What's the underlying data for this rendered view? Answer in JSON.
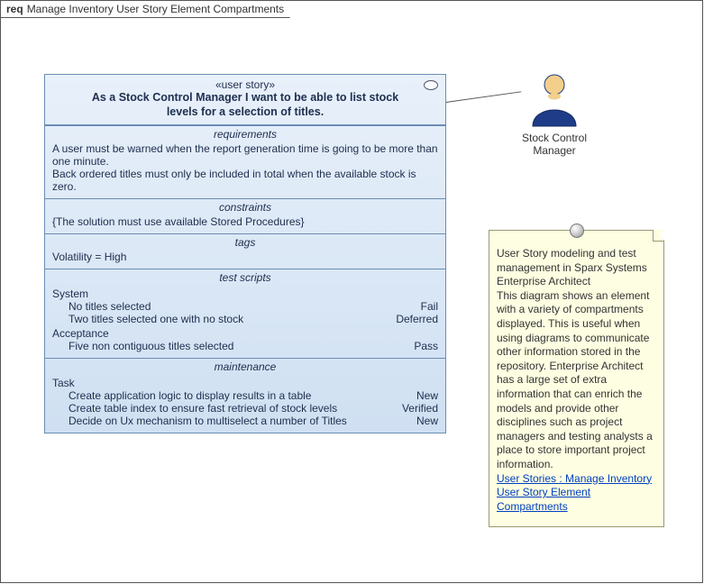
{
  "frame": {
    "prefix": "req",
    "title": "Manage Inventory User Story Element Compartments"
  },
  "story": {
    "stereotype": "«user story»",
    "title": "As a Stock Control Manager I want to be able to list stock levels for a selection of titles.",
    "requirements_label": "requirements",
    "requirements": {
      "r1": "A user must be warned when the report generation time is going to be more than one minute.",
      "r2": "Back ordered titles must only be included in total when the available stock is zero."
    },
    "constraints_label": "constraints",
    "constraints": {
      "c1": "{The solution must use available Stored Procedures}"
    },
    "tags_label": "tags",
    "tags": {
      "t1": "Volatility = High"
    },
    "test_scripts_label": "test scripts",
    "tests": {
      "system_label": "System",
      "system": {
        "s1_name": "No titles selected",
        "s1_status": "Fail",
        "s2_name": "Two titles selected one with no stock",
        "s2_status": "Deferred"
      },
      "acceptance_label": "Acceptance",
      "acceptance": {
        "a1_name": "Five non contiguous titles selected",
        "a1_status": "Pass"
      }
    },
    "maintenance_label": "maintenance",
    "maintenance": {
      "task_label": "Task",
      "m1_name": "Create application logic to display results in a table",
      "m1_status": "New",
      "m2_name": "Create table index to ensure fast retrieval of stock levels",
      "m2_status": "Verified",
      "m3_name": "Decide on Ux mechanism to multiselect a number of Titles",
      "m3_status": "New"
    }
  },
  "actor": {
    "label_l1": "Stock Control",
    "label_l2": "Manager"
  },
  "note": {
    "heading": "User Story modeling and test management in Sparx Systems Enterprise Architect",
    "body": "This diagram shows an element with a variety of compartments displayed. This is useful when using diagrams to communicate other information stored in the repository. Enterprise Architect has a large set of extra information that can enrich the models and provide other disciplines such as project managers and testing analysts a place to store important project information.",
    "link1": "User Stories : Manage Inventory User Story Element Compartments"
  }
}
